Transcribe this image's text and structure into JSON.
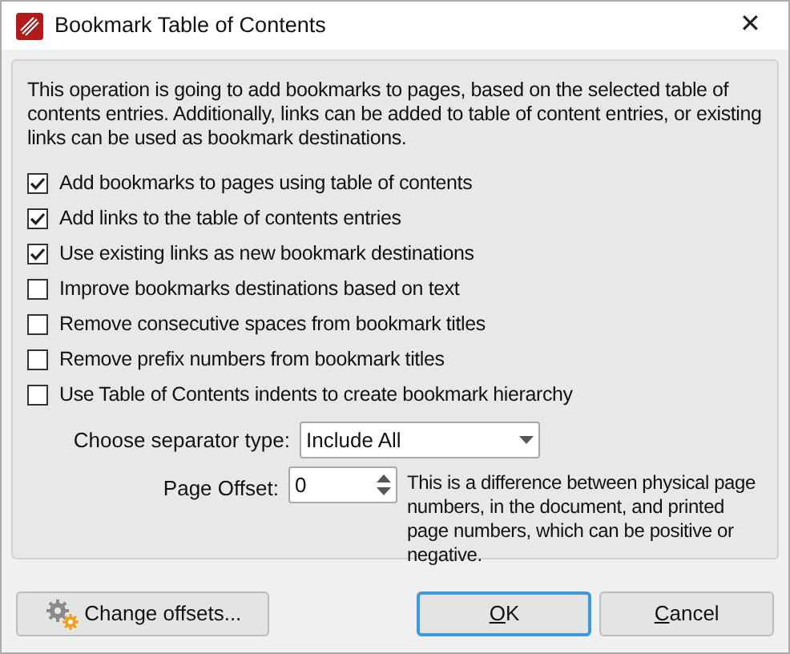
{
  "window": {
    "title": "Bookmark Table of Contents",
    "close": "✕"
  },
  "description": "This operation is going to add bookmarks to pages, based on the selected table of contents entries. Additionally, links can be added to table of content entries, or existing links can be used as bookmark destinations.",
  "options": [
    {
      "label": "Add bookmarks to pages using table of contents",
      "checked": true
    },
    {
      "label": "Add links to the table of contents entries",
      "checked": true
    },
    {
      "label": "Use existing links as new bookmark destinations",
      "checked": true
    },
    {
      "label": "Improve bookmarks destinations based on text",
      "checked": false
    },
    {
      "label": "Remove consecutive spaces from bookmark titles",
      "checked": false
    },
    {
      "label": "Remove prefix numbers from bookmark titles",
      "checked": false
    },
    {
      "label": "Use Table of Contents indents to create bookmark hierarchy",
      "checked": false
    }
  ],
  "separator": {
    "label": "Choose separator type:",
    "value": "Include All"
  },
  "page_offset": {
    "label": "Page Offset:",
    "value": "0",
    "note": "This is a difference between physical page numbers, in the document, and printed page numbers, which can be positive or negative."
  },
  "buttons": [
    {
      "label": "Change offsets...",
      "kind": "gear",
      "default": false
    },
    {
      "label": "OK",
      "kind": "plain",
      "default": true
    },
    {
      "label": "Cancel",
      "kind": "plain",
      "default": false
    }
  ]
}
